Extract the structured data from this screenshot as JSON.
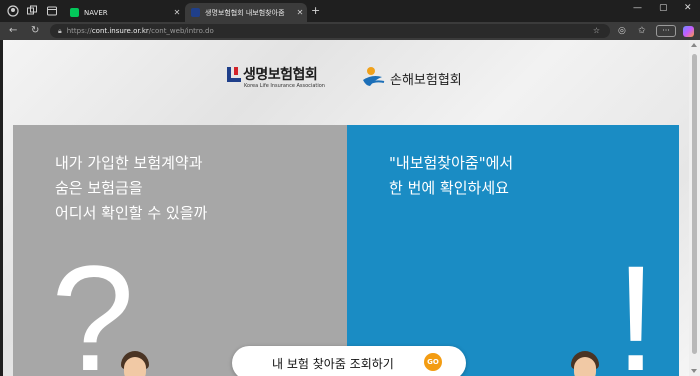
{
  "browser": {
    "tabs": [
      {
        "title": "NAVER",
        "favicon_color": "#03c75a",
        "active": false
      },
      {
        "title": "생명보험협회 내보험찾아줌",
        "favicon_color": "#1f3f8a",
        "active": true
      }
    ],
    "url": {
      "protocol": "https://",
      "host": "cont.insure.or.kr",
      "path": "/cont_web/intro.do"
    }
  },
  "page": {
    "life_logo": {
      "korean": "생명보험협회",
      "english": "Korea Life Insurance Association"
    },
    "nonlife_logo": {
      "korean": "손해보험협회"
    },
    "left_panel": {
      "color": "#a7a7a7",
      "lines": [
        "내가 가입한 보험계약과",
        "숨은 보험금을",
        "어디서 확인할 수 있을까"
      ],
      "mark": "?"
    },
    "right_panel": {
      "color": "#1a8cc4",
      "lines": [
        "\"내보험찾아줌\"에서",
        "한 번에 확인하세요"
      ],
      "mark": "!"
    },
    "cta": {
      "label": "내 보험 찾아줌 조회하기",
      "go": "GO",
      "go_color": "#f39c12"
    }
  }
}
